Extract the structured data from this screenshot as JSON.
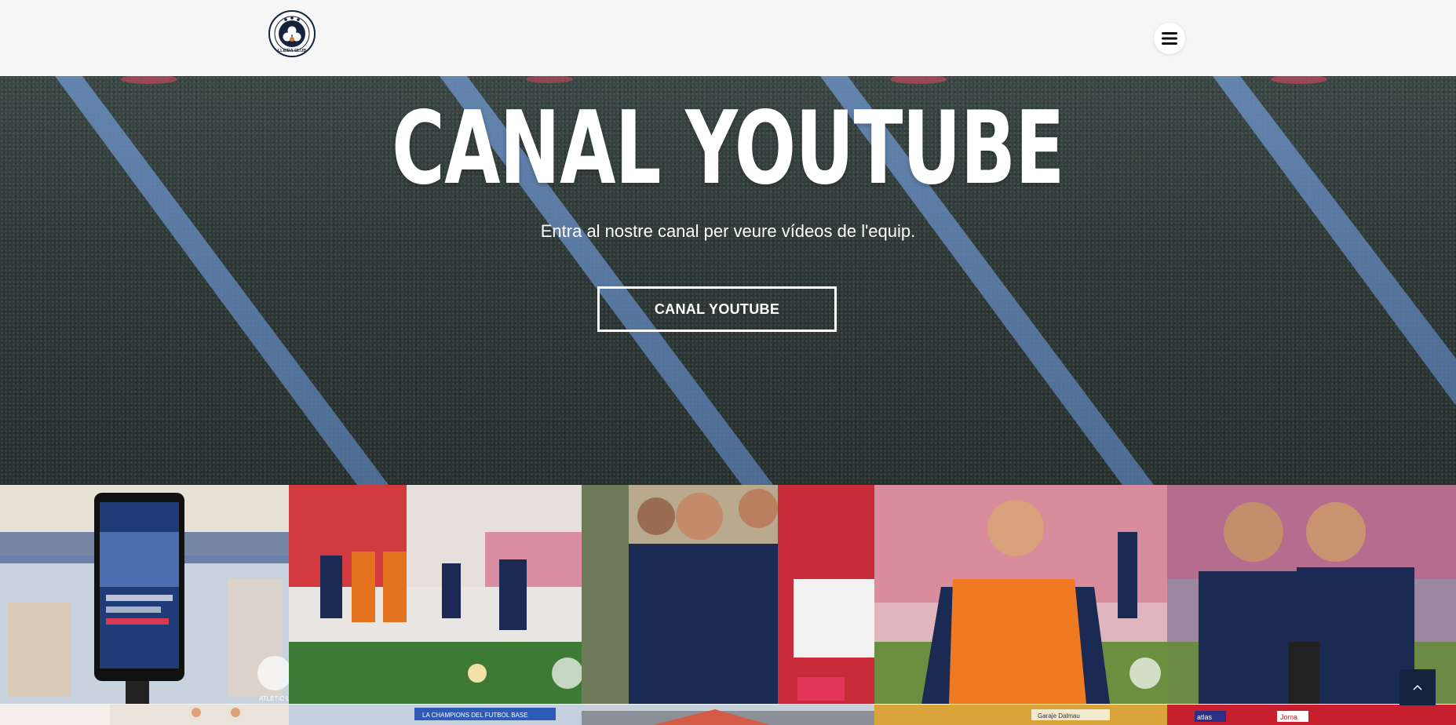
{
  "header": {
    "logo_text": "LLEIDA CLUB",
    "logo_alt": "Atlètic Lleida Club logo"
  },
  "hero": {
    "title": "CANAL YOUTUBE",
    "subtitle": "Entra al nostre canal per veure vídeos de l'equip.",
    "cta_label": "CANAL YOUTUBE"
  },
  "gallery": {
    "watermark": "ATLÈTIC LL",
    "row2_signs": [
      "LA CHAMPIONS DEL FUTBOL BASE",
      "Garaje Dalmau",
      "atlas",
      "Joma"
    ]
  },
  "colors": {
    "brand_navy": "#16233f",
    "pitch_green": "#2f3a38",
    "pitch_line_blue": "#5f86b8",
    "background": "#f6f6f6"
  },
  "icons": {
    "menu": "hamburger-icon",
    "scroll_top": "chevron-up-icon"
  }
}
